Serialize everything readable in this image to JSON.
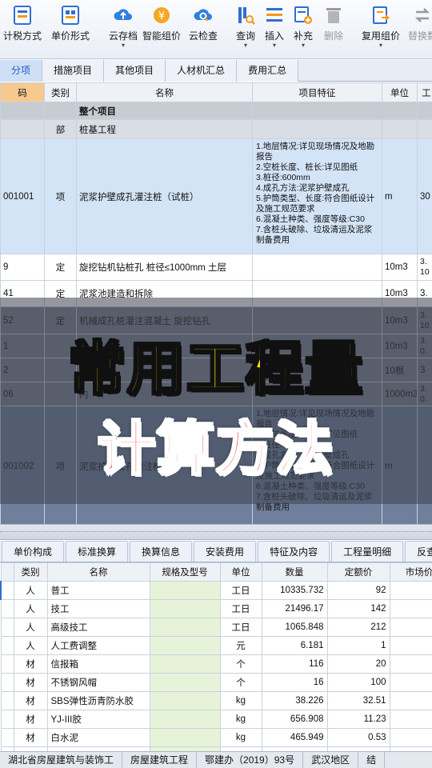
{
  "toolbar": {
    "buttons": [
      {
        "label": "计税方式",
        "icon": "tax-method-icon",
        "caret": false
      },
      {
        "label": "单价形式",
        "icon": "unit-price-form-icon",
        "caret": false
      },
      {
        "label": "云存档",
        "icon": "cloud-upload-icon",
        "caret": true
      },
      {
        "label": "智能组价",
        "icon": "smart-pricing-icon",
        "caret": false
      },
      {
        "label": "云检查",
        "icon": "cloud-check-icon",
        "caret": false
      },
      {
        "label": "查询",
        "icon": "query-icon",
        "caret": true
      },
      {
        "label": "插入",
        "icon": "insert-icon",
        "caret": true
      },
      {
        "label": "补充",
        "icon": "supplement-icon",
        "caret": true
      },
      {
        "label": "删除",
        "icon": "delete-icon",
        "caret": false,
        "disabled": true
      },
      {
        "label": "复用组价",
        "icon": "reuse-pricing-icon",
        "caret": true
      },
      {
        "label": "替换数",
        "icon": "replace-icon",
        "caret": false,
        "disabled": true
      }
    ]
  },
  "tabs": [
    "分项",
    "措施项目",
    "其他项目",
    "人材机汇总",
    "费用汇总"
  ],
  "grid1": {
    "headers": [
      "码",
      "类别",
      "名称",
      "项目特征",
      "单位",
      "工"
    ],
    "rows": [
      {
        "style": "top",
        "code": "",
        "type": "",
        "name": "整个项目",
        "spec": "",
        "unit": "",
        "qty": ""
      },
      {
        "style": "bu",
        "code": "",
        "type": "部",
        "name": "桩基工程",
        "spec": "",
        "unit": "",
        "qty": ""
      },
      {
        "style": "blue",
        "code": "001001",
        "type": "项",
        "name": "泥浆护壁成孔灌注桩（试桩）",
        "spec": "1.地层情况:详见现场情况及地勘报告\n2.空桩长度、桩长:详见图纸\n3.桩径:600mm\n4.成孔方法:泥浆护壁成孔\n5.护筒类型、长度:符合图纸设计及施工规范要求\n6.混凝土种类、强度等级:C30\n7.含桩头破除、垃圾清运及泥浆制备费用",
        "unit": "m",
        "qty": "30"
      },
      {
        "style": "white",
        "code": "9",
        "type": "定",
        "name": "旋挖钻机钻桩孔 桩径≤1000mm 土层",
        "spec": "",
        "unit": "10m3",
        "qty": "3.\n10"
      },
      {
        "style": "white",
        "code": "41",
        "type": "定",
        "name": "泥浆池建造和拆除",
        "spec": "",
        "unit": "10m3",
        "qty": "3."
      },
      {
        "style": "dark",
        "code": "52",
        "type": "定",
        "name": "机械成孔桩灌注混凝土 旋挖钻孔",
        "spec": "",
        "unit": "10m3",
        "qty": "3.\n10"
      },
      {
        "style": "dark",
        "code": "1",
        "type": "",
        "name": "",
        "spec": "",
        "unit": "10m3",
        "qty": "3.\n0."
      },
      {
        "style": "dark",
        "code": "2",
        "type": "",
        "name": "",
        "spec": "",
        "unit": "10根",
        "qty": "3"
      },
      {
        "style": "dark",
        "code": "06",
        "type": "",
        "name": "内",
        "spec": "",
        "unit": "1000m3",
        "qty": "3.\n0."
      },
      {
        "style": "darkblue",
        "code": "001002",
        "type": "项",
        "name": "泥浆护壁成孔灌注桩",
        "spec": "1.地层情况:详见现场情况及地勘报告\n2.空桩长度、桩长:详见图纸\n3.桩径:600mm\n4.成孔方法:泥浆护壁成孔\n5.护筒类型、长度:符合图纸设计及施工规范要求\n6.混凝土种类、强度等级:C30\n7.含桩头破除、垃圾清运及泥浆制备费用",
        "unit": "m",
        "qty": ""
      }
    ]
  },
  "headline": {
    "line1": "常用工程量",
    "line2": "计算方法"
  },
  "tabs2": [
    "单价构成",
    "标准换算",
    "换算信息",
    "安装费用",
    "特征及内容",
    "工程量明细",
    "反查"
  ],
  "grid2": {
    "headers": [
      "",
      "类别",
      "名称",
      "规格及型号",
      "单位",
      "数量",
      "定额价",
      "市场价"
    ],
    "rows": [
      [
        "",
        "人",
        "普工",
        "",
        "工日",
        "10335.732",
        "92",
        ""
      ],
      [
        "",
        "人",
        "技工",
        "",
        "工日",
        "21496.17",
        "142",
        ""
      ],
      [
        "",
        "人",
        "高级技工",
        "",
        "工日",
        "1065.848",
        "212",
        ""
      ],
      [
        "",
        "人",
        "人工费调整",
        "",
        "元",
        "6.181",
        "1",
        ""
      ],
      [
        "",
        "材",
        "信报箱",
        "",
        "个",
        "116",
        "20",
        ""
      ],
      [
        "",
        "材",
        "不锈钢风帽",
        "",
        "个",
        "16",
        "100",
        ""
      ],
      [
        "",
        "材",
        "SBS弹性沥青防水胶",
        "",
        "kg",
        "38.226",
        "32.51",
        "33"
      ],
      [
        "",
        "材",
        "YJ-III胶",
        "",
        "kg",
        "656.908",
        "11.23",
        "12"
      ],
      [
        "",
        "材",
        "白水泥",
        "",
        "kg",
        "465.949",
        "0.53",
        "0"
      ],
      [
        "",
        "材",
        "",
        "",
        "",
        "",
        "",
        ""
      ]
    ]
  },
  "status": [
    "湖北省房屋建筑与装饰工",
    "房屋建筑工程",
    "鄂建办（2019）93号",
    "武汉地区",
    "结"
  ]
}
